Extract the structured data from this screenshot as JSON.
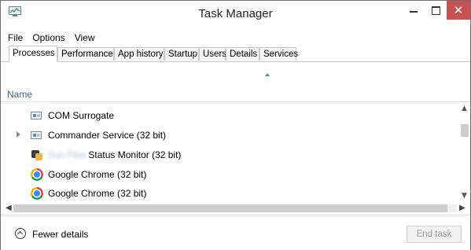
{
  "window": {
    "title": "Task Manager"
  },
  "menu": [
    "File",
    "Options",
    "View"
  ],
  "tabs": [
    {
      "label": "Processes",
      "active": true
    },
    {
      "label": "Performance"
    },
    {
      "label": "App history"
    },
    {
      "label": "Startup"
    },
    {
      "label": "Users"
    },
    {
      "label": "Details"
    },
    {
      "label": "Services"
    }
  ],
  "list_header": {
    "name": "Name"
  },
  "processes": [
    {
      "label": "COM Surrogate",
      "icon": "window-icon"
    },
    {
      "label": "Commander Service (32 bit)",
      "icon": "window-icon",
      "expandable": true
    },
    {
      "label_hidden": "Sun Plus",
      "label": "Status Monitor (32 bit)",
      "icon": "monitor-icon"
    },
    {
      "label": "Google Chrome (32 bit)",
      "icon": "chrome-icon"
    },
    {
      "label": "Google Chrome (32 bit)",
      "icon": "chrome-icon"
    }
  ],
  "footer": {
    "fewer_details": "Fewer details",
    "end_task": "End task"
  },
  "colors": {
    "close_button": "#c75050",
    "accent": "#4a86c5"
  }
}
